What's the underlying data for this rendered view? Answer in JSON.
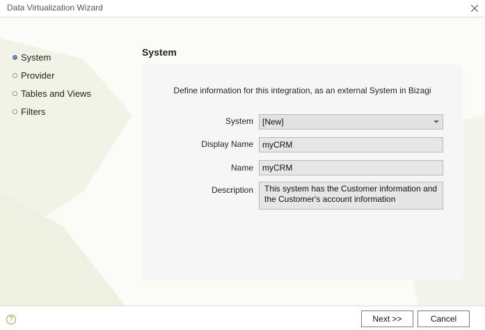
{
  "window": {
    "title": "Data Virtualization Wizard"
  },
  "steps": [
    {
      "label": "System",
      "active": true
    },
    {
      "label": "Provider",
      "active": false
    },
    {
      "label": "Tables and Views",
      "active": false
    },
    {
      "label": "Filters",
      "active": false
    }
  ],
  "section": {
    "title": "System",
    "intro": "Define information for this integration, as an external System in Bizagi"
  },
  "form": {
    "system": {
      "label": "System",
      "value": "[New]"
    },
    "display_name": {
      "label": "Display Name",
      "value": "myCRM"
    },
    "name": {
      "label": "Name",
      "value": "myCRM"
    },
    "description": {
      "label": "Description",
      "line1": "This system has the Customer information and",
      "line2": "the Customer's account information"
    }
  },
  "footer": {
    "help_icon": "help-icon",
    "next_label": "Next >>",
    "cancel_label": "Cancel"
  },
  "colors": {
    "active_bullet": "#6b8fc7",
    "help": "#7a9a3a",
    "field_bg": "#e6e6e6"
  }
}
